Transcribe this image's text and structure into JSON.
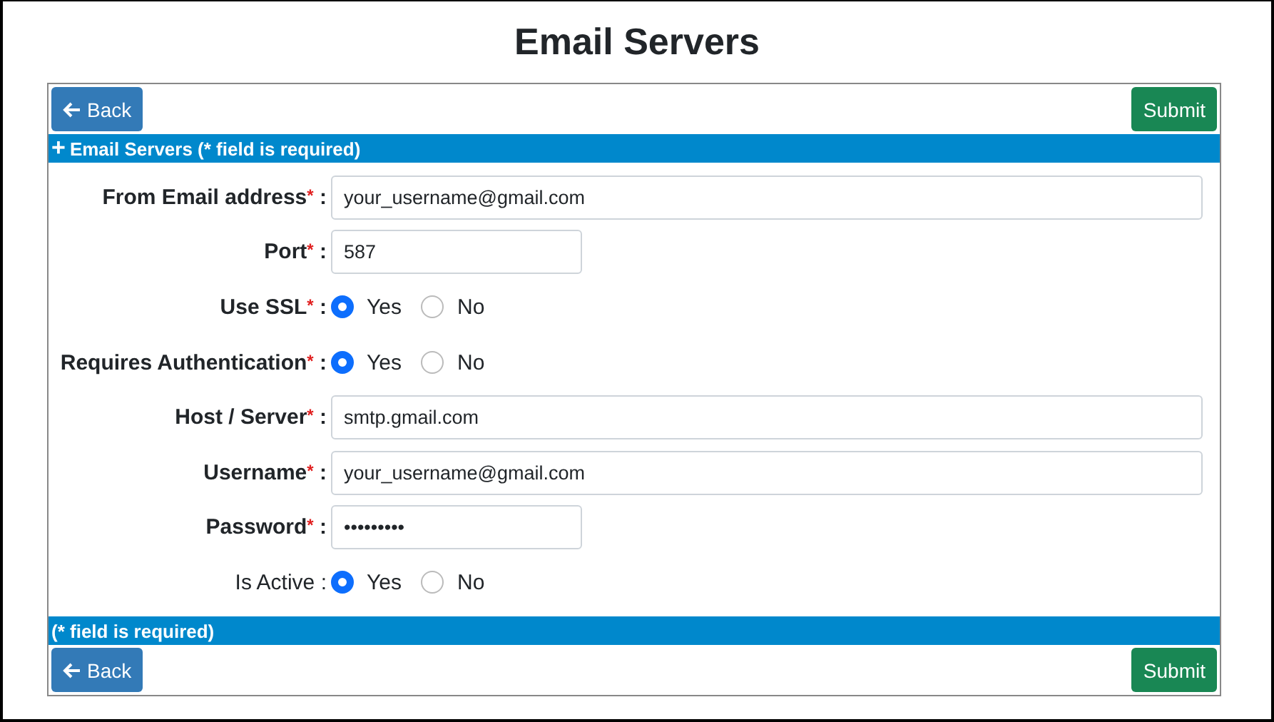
{
  "title": "Email Servers",
  "top_buttons": {
    "back": "Back",
    "submit": "Submit"
  },
  "header": {
    "icon": "+",
    "text": "Email Servers (* field is required)"
  },
  "fields": [
    {
      "kind": "text",
      "label": "From Email address",
      "required": true,
      "mark": "*",
      "colon": ":",
      "value": "your_username@gmail.com",
      "wide": true
    },
    {
      "kind": "text",
      "label": "Port",
      "required": true,
      "mark": "*",
      "colon": ":",
      "value": "587",
      "wide": false
    },
    {
      "kind": "radio",
      "label": "Use SSL",
      "required": true,
      "mark": "*",
      "colon": ":",
      "options": [
        {
          "label": "Yes",
          "selected": true
        },
        {
          "label": "No",
          "selected": false
        }
      ]
    },
    {
      "kind": "radio",
      "label": "Requires Authentication",
      "required": true,
      "mark": "*",
      "colon": ":",
      "options": [
        {
          "label": "Yes",
          "selected": true
        },
        {
          "label": "No",
          "selected": false
        }
      ]
    },
    {
      "kind": "text",
      "label": "Host / Server",
      "required": true,
      "mark": "*",
      "colon": ":",
      "value": "smtp.gmail.com",
      "wide": true
    },
    {
      "kind": "text",
      "label": "Username",
      "required": true,
      "mark": "*",
      "colon": ":",
      "value": "your_username@gmail.com",
      "wide": true
    },
    {
      "kind": "text",
      "label": "Password",
      "required": true,
      "mark": "*",
      "colon": ":",
      "value": "•••••••••",
      "wide": false
    },
    {
      "kind": "radio",
      "label": "Is Active",
      "required": false,
      "colon": ":",
      "options": [
        {
          "label": "Yes",
          "selected": true
        },
        {
          "label": "No",
          "selected": false
        }
      ]
    }
  ],
  "footer": {
    "text": "(* field is required)"
  },
  "bottom_buttons": {
    "back": "Back",
    "submit": "Submit"
  }
}
